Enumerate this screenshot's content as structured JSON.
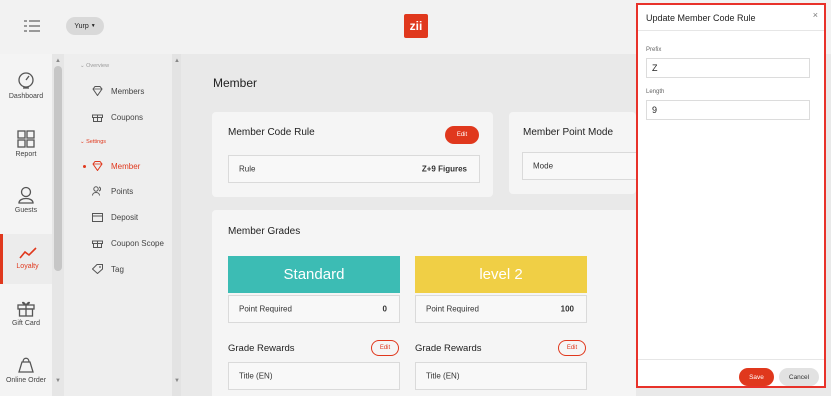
{
  "topbar": {
    "store_label": "Yurp",
    "logo": "zii",
    "menu_icon": "menu-icon",
    "dropdown_icon": "chevron-down-icon"
  },
  "rail": {
    "items": [
      {
        "label": "Dashboard",
        "icon": "dashboard-icon"
      },
      {
        "label": "Report",
        "icon": "grid-icon"
      },
      {
        "label": "Guests",
        "icon": "user-icon"
      },
      {
        "label": "Loyalty",
        "icon": "trend-icon"
      },
      {
        "label": "Gift Card",
        "icon": "gift-icon"
      },
      {
        "label": "Online Order",
        "icon": "bag-icon"
      }
    ]
  },
  "submenu": {
    "overview_title": "Overview",
    "settings_title": "Settings",
    "items": [
      {
        "label": "Members",
        "icon": "diamond-icon"
      },
      {
        "label": "Coupons",
        "icon": "gift-icon"
      },
      {
        "label": "Member",
        "icon": "diamond-icon"
      },
      {
        "label": "Points",
        "icon": "users-icon"
      },
      {
        "label": "Deposit",
        "icon": "wallet-icon"
      },
      {
        "label": "Coupon Scope",
        "icon": "gift-icon"
      },
      {
        "label": "Tag",
        "icon": "tag-icon"
      }
    ]
  },
  "main": {
    "title": "Member",
    "code_rule": {
      "title": "Member Code Rule",
      "edit": "Edit",
      "rule_label": "Rule",
      "rule_value": "Z+9 Figures"
    },
    "point_mode": {
      "title": "Member Point Mode",
      "mode_label": "Mode"
    },
    "grades": {
      "title": "Member Grades",
      "items": [
        {
          "name": "Standard",
          "point_label": "Point Required",
          "points": "0",
          "rewards_title": "Grade Rewards",
          "edit": "Edit",
          "title_label": "Title (EN)"
        },
        {
          "name": "level 2",
          "point_label": "Point Required",
          "points": "100",
          "rewards_title": "Grade Rewards",
          "edit": "Edit",
          "title_label": "Title (EN)"
        }
      ]
    }
  },
  "dialog": {
    "title": "Update Member Code Rule",
    "close": "×",
    "prefix_label": "Prefix",
    "prefix_value": "Z",
    "length_label": "Length",
    "length_value": "9",
    "save": "Save",
    "cancel": "Cancel"
  },
  "colors": {
    "accent": "#e0381d",
    "teal": "#3cbcb4",
    "gold": "#f0cf45",
    "highlight_border": "#e8322a"
  }
}
